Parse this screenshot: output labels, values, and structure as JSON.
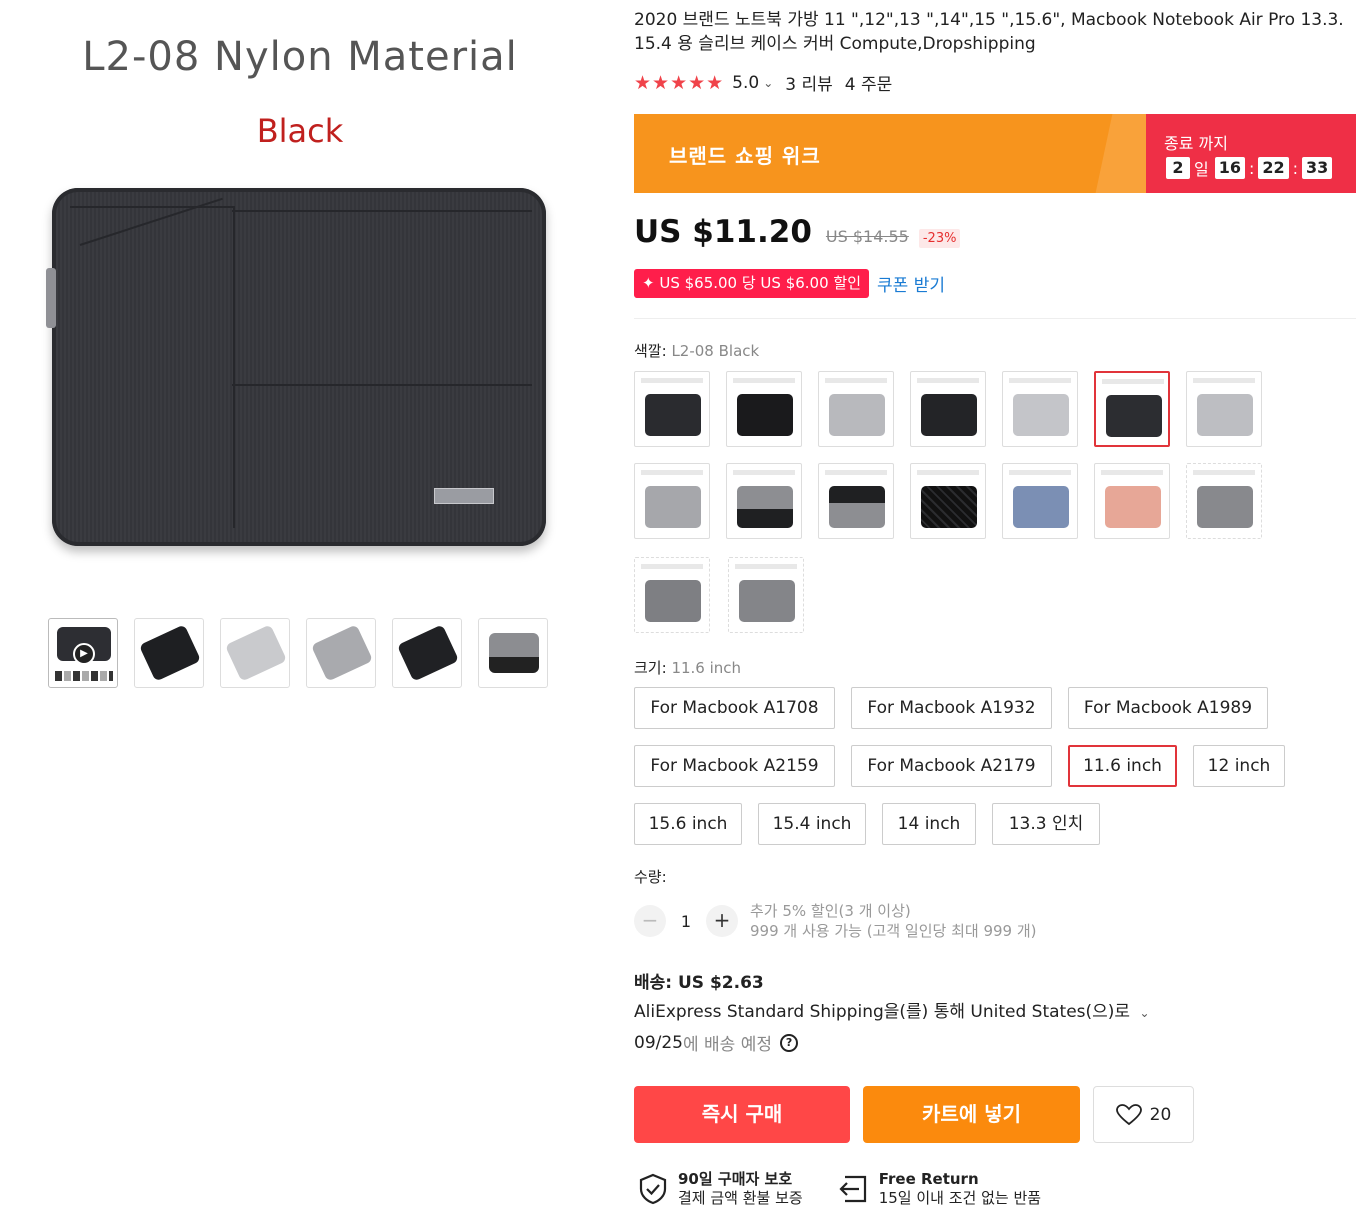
{
  "gallery": {
    "main_caption_line1": "L2-08 Nylon Material",
    "main_caption_line2": "Black",
    "thumbnails": [
      "video-thumb",
      "black-quilted",
      "light-gray",
      "gray-felt",
      "black-angled",
      "gray-black"
    ]
  },
  "product": {
    "title": "2020 브랜드 노트북 가방 11 \",12\",13 \",14\",15 \",15.6\", Macbook Notebook Air Pro 13.3. 15.4 용 슬리브 케이스 커버 Compute,Dropshipping",
    "rating": "5.0",
    "reviews": "3 리뷰",
    "orders": "4 주문"
  },
  "promo": {
    "banner_label": "브랜드 쇼핑 위크",
    "ends_label": "종료 까지",
    "days": "2",
    "days_unit": "일",
    "hours": "16",
    "minutes": "22",
    "seconds": "33"
  },
  "price": {
    "current": "US $11.20",
    "original": "US $14.55",
    "discount": "-23%"
  },
  "coupon": {
    "tag": "✦ US $65.00 당 US $6.00 할인",
    "link": "쿠폰 받기"
  },
  "color": {
    "label": "색깔:",
    "selected": "L2-08 Black"
  },
  "size": {
    "label": "크기:",
    "selected": "11.6 inch",
    "options": [
      "For Macbook A1708",
      "For Macbook A1932",
      "For Macbook A1989",
      "For Macbook A2159",
      "For Macbook A2179",
      "11.6 inch",
      "12 inch",
      "15.6 inch",
      "15.4 inch",
      "14 inch",
      "13.3 인치"
    ]
  },
  "quantity": {
    "label": "수량:",
    "value": "1",
    "minus": "−",
    "plus": "+",
    "note1": "추가 5% 할인(3 개 이상)",
    "note2": "999 개 사용 가능 (고객 일인당 최대 999 개)"
  },
  "shipping": {
    "title": "배송: US $2.63",
    "line": "AliExpress Standard Shipping을(를) 통해 United States(으)로",
    "date": "09/25",
    "date_suffix": "에 배송 예정",
    "help": "?"
  },
  "actions": {
    "buy_now": "즉시 구매",
    "add_to_cart": "카트에 넣기",
    "wishlist_count": "20"
  },
  "badges": {
    "protection_title": "90일 구매자 보호",
    "protection_sub": "결제 금액 환불 보증",
    "return_title": "Free Return",
    "return_sub": "15일 이내 조건 없는 반품"
  },
  "colors": {
    "accent_red": "#ff4747",
    "orange": "#fb8a0d",
    "star": "#f0434a",
    "link_blue": "#1a7bd3"
  }
}
